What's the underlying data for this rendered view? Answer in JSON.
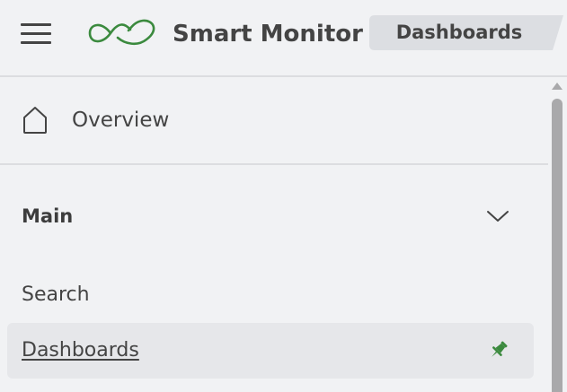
{
  "header": {
    "menu_icon": "hamburger-menu-icon",
    "logo_icon": "infinity-loop-logo",
    "brand_color": "#3b8a3e",
    "app_title": "Smart Monitor",
    "breadcrumb": "Dashboards"
  },
  "sidebar": {
    "overview": {
      "label": "Overview",
      "icon": "home-icon"
    },
    "section": {
      "label": "Main",
      "icon": "chevron-down-icon",
      "expanded": true
    },
    "items": [
      {
        "label": "Search",
        "active": false
      },
      {
        "label": "Dashboards",
        "active": true,
        "icon": "pin-icon",
        "icon_color": "#3b8a3e"
      }
    ]
  }
}
